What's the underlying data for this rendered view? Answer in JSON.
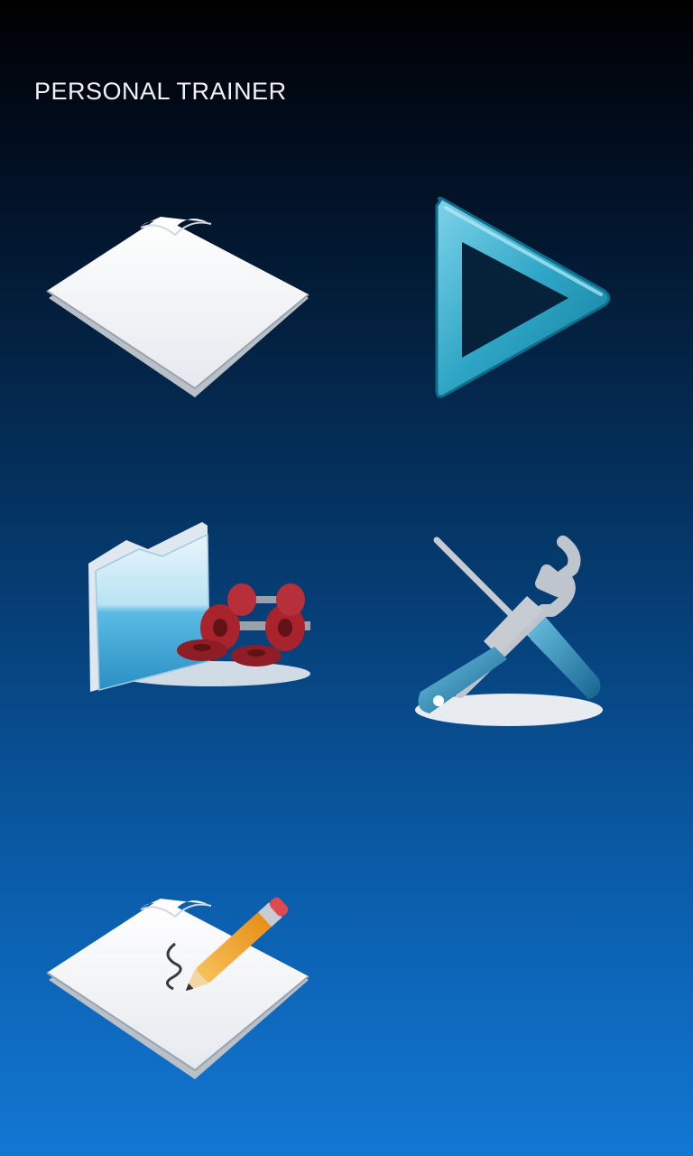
{
  "app": {
    "title": "PERSONAL TRAINER"
  },
  "colors": {
    "background_top": "#000000",
    "background_bottom": "#1277d3",
    "title_text": "#f2f2f2",
    "play_teal": "#2fa6c6",
    "tool_blue": "#1f86b3",
    "folder_blue": "#4fb3e0",
    "dumbbell_red": "#a8232c",
    "pencil_orange": "#f2a52a"
  },
  "tiles": [
    {
      "id": "new",
      "icon": "blank-document-icon"
    },
    {
      "id": "play",
      "icon": "play-triangle-icon"
    },
    {
      "id": "workouts",
      "icon": "folder-dumbbells-icon"
    },
    {
      "id": "settings",
      "icon": "wrench-screwdriver-icon"
    },
    {
      "id": "edit",
      "icon": "document-pencil-icon"
    }
  ]
}
